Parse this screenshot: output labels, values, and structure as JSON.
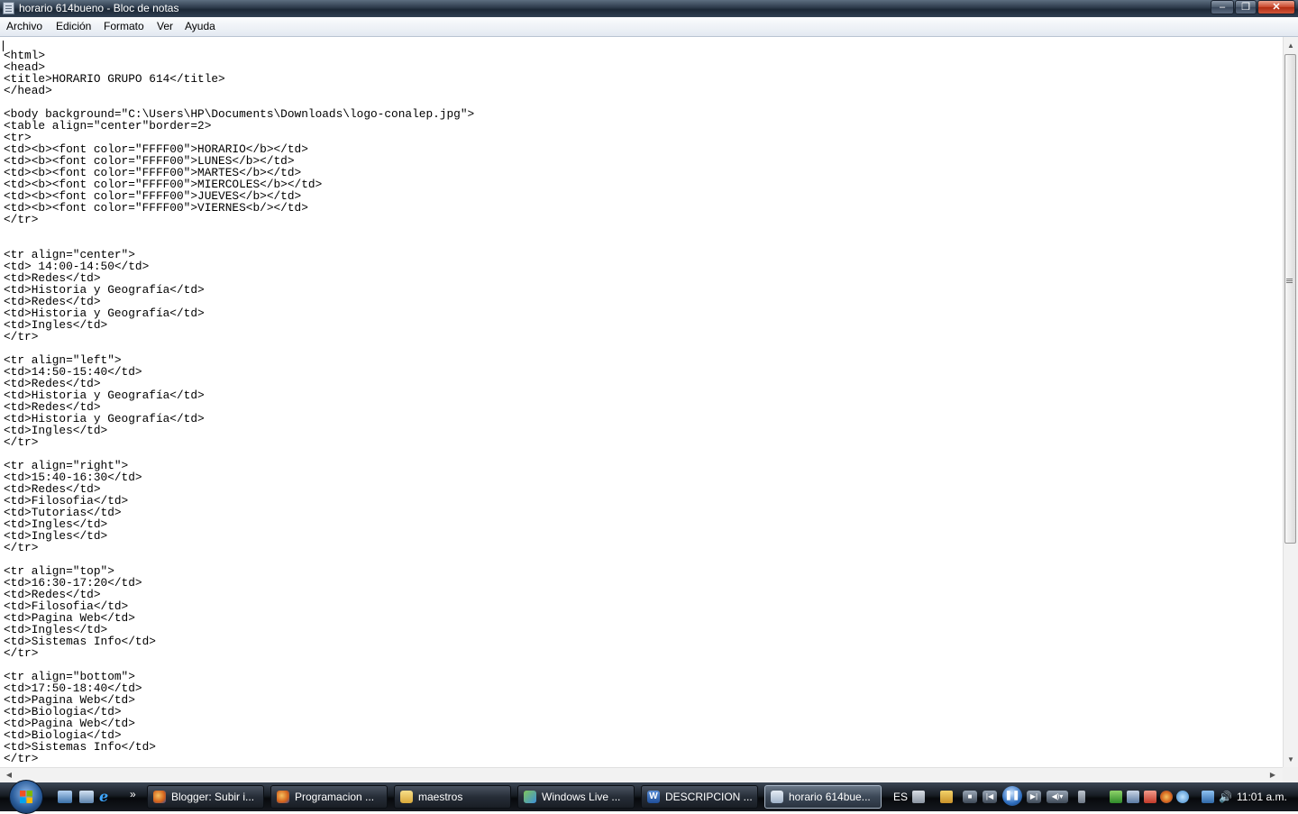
{
  "window": {
    "title": "horario 614bueno - Bloc de notas",
    "minimize_glyph": "‒",
    "maximize_glyph": "❐",
    "close_glyph": "✕"
  },
  "menu": {
    "items": [
      "Archivo",
      "Edición",
      "Formato",
      "Ver",
      "Ayuda"
    ]
  },
  "editor": {
    "lines": [
      "",
      "<html>",
      "<head>",
      "<title>HORARIO GRUPO 614</title>",
      "</head>",
      "",
      "<body background=\"C:\\Users\\HP\\Documents\\Downloads\\logo-conalep.jpg\">",
      "<table align=\"center\"border=2>",
      "<tr>",
      "<td><b><font color=\"FFFF00\">HORARIO</b></td>",
      "<td><b><font color=\"FFFF00\">LUNES</b></td>",
      "<td><b><font color=\"FFFF00\">MARTES</b></td>",
      "<td><b><font color=\"FFFF00\">MIERCOLES</b></td>",
      "<td><b><font color=\"FFFF00\">JUEVES</b></td>",
      "<td><b><font color=\"FFFF00\">VIERNES<b/></td>",
      "</tr>",
      "",
      "",
      "<tr align=\"center\">",
      "<td> 14:00-14:50</td>",
      "<td>Redes</td>",
      "<td>Historia y Geografía</td>",
      "<td>Redes</td>",
      "<td>Historia y Geografía</td>",
      "<td>Ingles</td>",
      "</tr>",
      "",
      "<tr align=\"left\">",
      "<td>14:50-15:40</td>",
      "<td>Redes</td>",
      "<td>Historia y Geografía</td>",
      "<td>Redes</td>",
      "<td>Historia y Geografía</td>",
      "<td>Ingles</td>",
      "</tr>",
      "",
      "<tr align=\"right\">",
      "<td>15:40-16:30</td>",
      "<td>Redes</td>",
      "<td>Filosofia</td>",
      "<td>Tutorias</td>",
      "<td>Ingles</td>",
      "<td>Ingles</td>",
      "</tr>",
      "",
      "<tr align=\"top\">",
      "<td>16:30-17:20</td>",
      "<td>Redes</td>",
      "<td>Filosofia</td>",
      "<td>Pagina Web</td>",
      "<td>Ingles</td>",
      "<td>Sistemas Info</td>",
      "</tr>",
      "",
      "<tr align=\"bottom\">",
      "<td>17:50-18:40</td>",
      "<td>Pagina Web</td>",
      "<td>Biologia</td>",
      "<td>Pagina Web</td>",
      "<td>Biologia</td>",
      "<td>Sistemas Info</td>",
      "</tr>"
    ]
  },
  "taskbar": {
    "quicklaunch_more": "»",
    "tasks": [
      {
        "label": "Blogger: Subir i...",
        "icon": "firefox-icon"
      },
      {
        "label": "Programacion ...",
        "icon": "firefox-icon"
      },
      {
        "label": "maestros",
        "icon": "folder-icon"
      },
      {
        "label": "Windows Live ...",
        "icon": "windows-live-icon"
      },
      {
        "label": "DESCRIPCION ...",
        "icon": "word-icon"
      },
      {
        "label": "horario 614bue...",
        "icon": "notepad-icon",
        "active": true
      }
    ],
    "language": "ES",
    "clock": "11:01 a.m."
  }
}
